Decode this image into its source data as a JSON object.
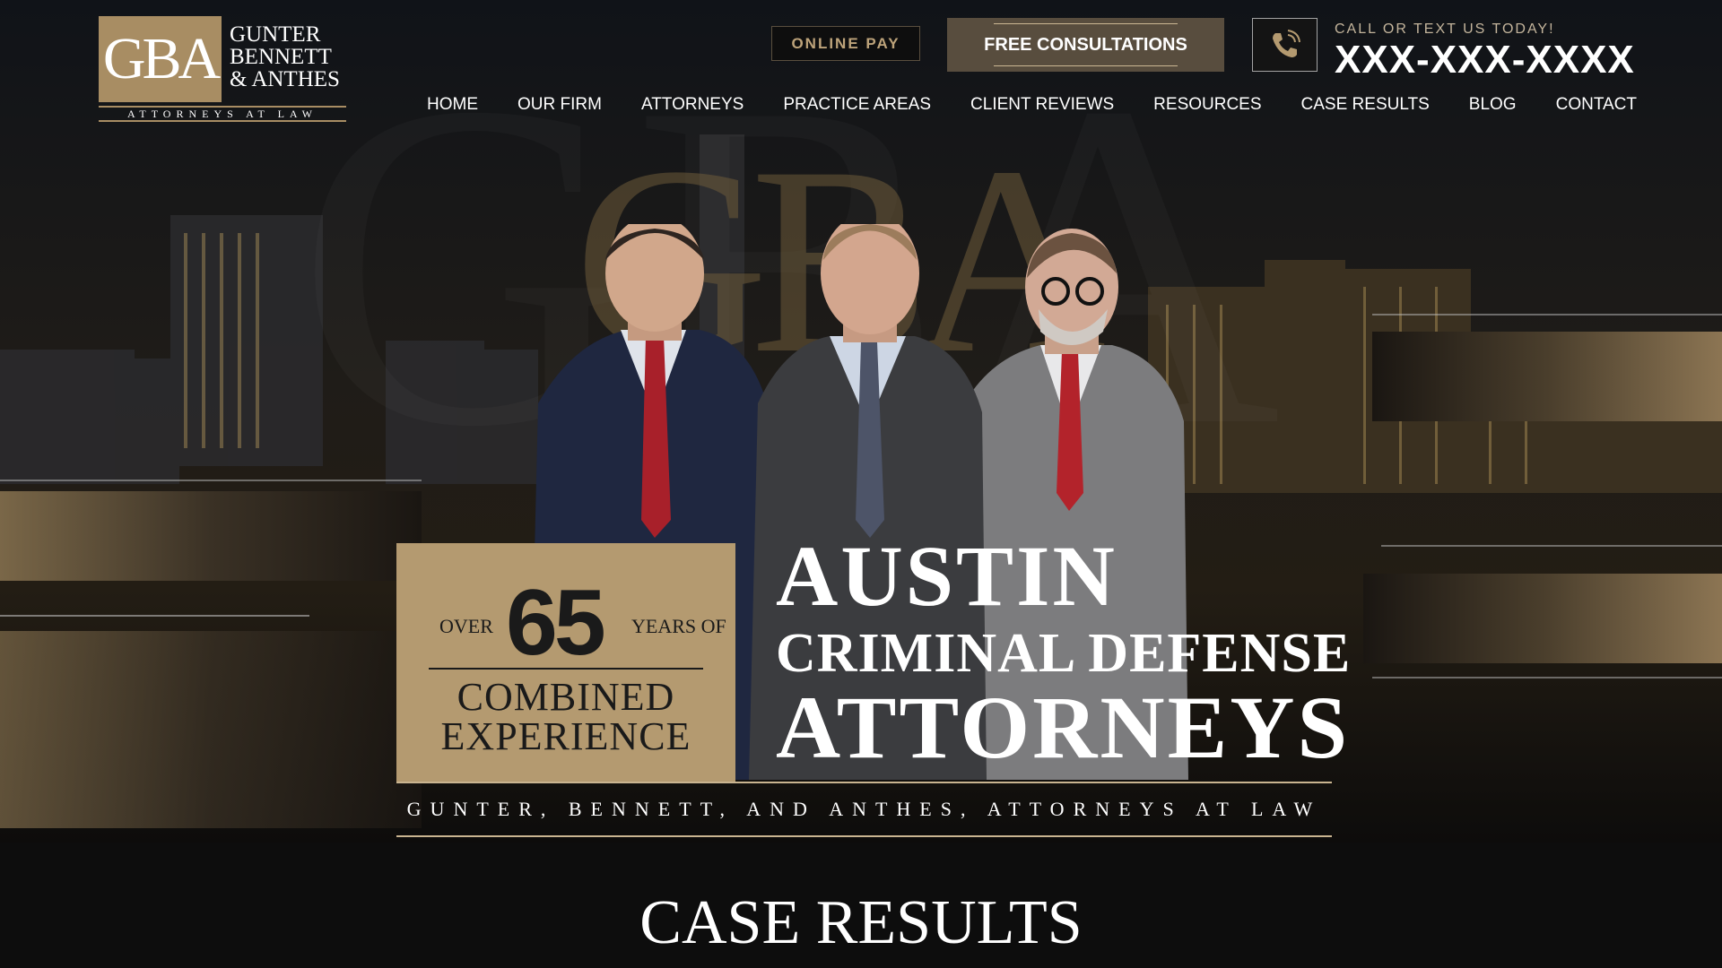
{
  "brand": {
    "monogram": "GBA",
    "name_lines": [
      "GUNTER",
      "BENNETT",
      "& ANTHES"
    ],
    "tagline": "ATTORNEYS AT LAW",
    "gold": "#b49a70"
  },
  "header": {
    "online_pay": "ONLINE PAY",
    "free_consult": "FREE CONSULTATIONS",
    "phone_icon": "phone-icon",
    "call_text": "CALL OR TEXT US TODAY!",
    "phone_number": "XXX-XXX-XXXX"
  },
  "nav": [
    "HOME",
    "OUR FIRM",
    "ATTORNEYS",
    "PRACTICE AREAS",
    "CLIENT REVIEWS",
    "RESOURCES",
    "CASE RESULTS",
    "BLOG",
    "CONTACT"
  ],
  "hero": {
    "bg_monogram": "GBA",
    "exp_over": "OVER",
    "exp_number": "65",
    "exp_years": "YEARS OF",
    "exp_combined_1": "COMBINED",
    "exp_combined_2": "EXPERIENCE",
    "headline_1": "AUSTIN",
    "headline_2": "CRIMINAL DEFENSE",
    "headline_3": "ATTORNEYS",
    "firm_line": "GUNTER, BENNETT, AND ANTHES, ATTORNEYS AT LAW"
  },
  "case_results": {
    "title": "CASE RESULTS"
  }
}
